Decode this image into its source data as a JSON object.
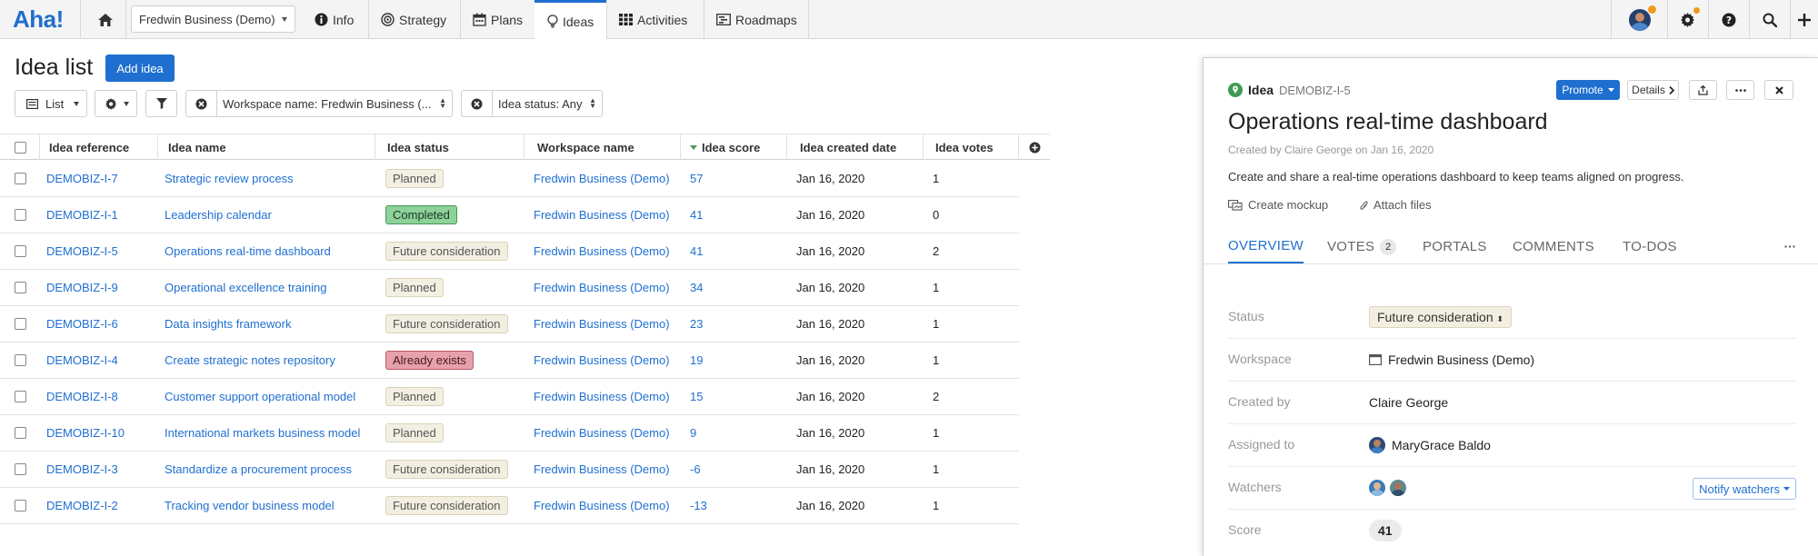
{
  "nav": {
    "logo": "Aha!",
    "workspace": "Fredwin Business (Demo)",
    "tabs": [
      {
        "label": "Info",
        "icon": "info-icon"
      },
      {
        "label": "Strategy",
        "icon": "target-icon"
      },
      {
        "label": "Plans",
        "icon": "calendar-icon"
      },
      {
        "label": "Ideas",
        "icon": "lightbulb-icon"
      },
      {
        "label": "Activities",
        "icon": "grid-icon"
      },
      {
        "label": "Roadmaps",
        "icon": "roadmap-icon"
      }
    ],
    "active_tab": "Ideas",
    "accent": "#1f6fd0",
    "notify_dot": "#f39a1e"
  },
  "list": {
    "title": "Idea list",
    "add_label": "Add idea",
    "view_label": "List",
    "filter_workspace": "Workspace name: Fredwin Business (...",
    "filter_status": "Idea status: Any",
    "columns": [
      "Idea reference",
      "Idea name",
      "Idea status",
      "Workspace name",
      "Idea score",
      "Idea created date",
      "Idea votes"
    ],
    "rows": [
      {
        "ref": "DEMOBIZ-I-7",
        "name": "Strategic review process",
        "status": "Planned",
        "workspace": "Fredwin Business (Demo)",
        "score": "57",
        "date": "Jan 16, 2020",
        "votes": "1"
      },
      {
        "ref": "DEMOBIZ-I-1",
        "name": "Leadership calendar",
        "status": "Completed",
        "workspace": "Fredwin Business (Demo)",
        "score": "41",
        "date": "Jan 16, 2020",
        "votes": "0"
      },
      {
        "ref": "DEMOBIZ-I-5",
        "name": "Operations real-time dashboard",
        "status": "Future consideration",
        "workspace": "Fredwin Business (Demo)",
        "score": "41",
        "date": "Jan 16, 2020",
        "votes": "2"
      },
      {
        "ref": "DEMOBIZ-I-9",
        "name": "Operational excellence training",
        "status": "Planned",
        "workspace": "Fredwin Business (Demo)",
        "score": "34",
        "date": "Jan 16, 2020",
        "votes": "1"
      },
      {
        "ref": "DEMOBIZ-I-6",
        "name": "Data insights framework",
        "status": "Future consideration",
        "workspace": "Fredwin Business (Demo)",
        "score": "23",
        "date": "Jan 16, 2020",
        "votes": "1"
      },
      {
        "ref": "DEMOBIZ-I-4",
        "name": "Create strategic notes repository",
        "status": "Already exists",
        "workspace": "Fredwin Business (Demo)",
        "score": "19",
        "date": "Jan 16, 2020",
        "votes": "1"
      },
      {
        "ref": "DEMOBIZ-I-8",
        "name": "Customer support operational model",
        "status": "Planned",
        "workspace": "Fredwin Business (Demo)",
        "score": "15",
        "date": "Jan 16, 2020",
        "votes": "2"
      },
      {
        "ref": "DEMOBIZ-I-10",
        "name": "International markets business model",
        "status": "Planned",
        "workspace": "Fredwin Business (Demo)",
        "score": "9",
        "date": "Jan 16, 2020",
        "votes": "1"
      },
      {
        "ref": "DEMOBIZ-I-3",
        "name": "Standardize a procurement process",
        "status": "Future consideration",
        "workspace": "Fredwin Business (Demo)",
        "score": "-6",
        "date": "Jan 16, 2020",
        "votes": "1"
      },
      {
        "ref": "DEMOBIZ-I-2",
        "name": "Tracking vendor business model",
        "status": "Future consideration",
        "workspace": "Fredwin Business (Demo)",
        "score": "-13",
        "date": "Jan 16, 2020",
        "votes": "1"
      }
    ],
    "status_colors": {
      "Planned": {
        "bg": "#f3f0e3",
        "border": "#d9d2b8",
        "text": "#555"
      },
      "Completed": {
        "bg": "#8ed19a",
        "border": "#3f9a54",
        "text": "#173d20"
      },
      "Future consideration": {
        "bg": "#f2efe2",
        "border": "#d9d2b8",
        "text": "#555"
      },
      "Already exists": {
        "bg": "#e6a1ab",
        "border": "#b85b69",
        "text": "#4a1820"
      }
    }
  },
  "detail": {
    "type_label": "Idea",
    "ref": "DEMOBIZ-I-5",
    "promote_label": "Promote",
    "details_label": "Details",
    "title": "Operations real-time dashboard",
    "created": "Created by Claire George on Jan 16, 2020",
    "description": "Create and share a real-time operations dashboard to keep teams aligned on progress.",
    "create_mockup": "Create mockup",
    "attach_files": "Attach files",
    "tabs": [
      {
        "label": "OVERVIEW"
      },
      {
        "label": "VOTES",
        "badge": "2"
      },
      {
        "label": "PORTALS"
      },
      {
        "label": "COMMENTS"
      },
      {
        "label": "TO-DOS"
      }
    ],
    "fields": {
      "status_label": "Status",
      "status_value": "Future consideration",
      "workspace_label": "Workspace",
      "workspace_value": "Fredwin Business (Demo)",
      "created_by_label": "Created by",
      "created_by_value": "Claire George",
      "assigned_label": "Assigned to",
      "assigned_value": "MaryGrace Baldo",
      "watchers_label": "Watchers",
      "notify_label": "Notify watchers",
      "score_label": "Score",
      "score_value": "41"
    },
    "idea_icon_color": "#3f9a54"
  }
}
